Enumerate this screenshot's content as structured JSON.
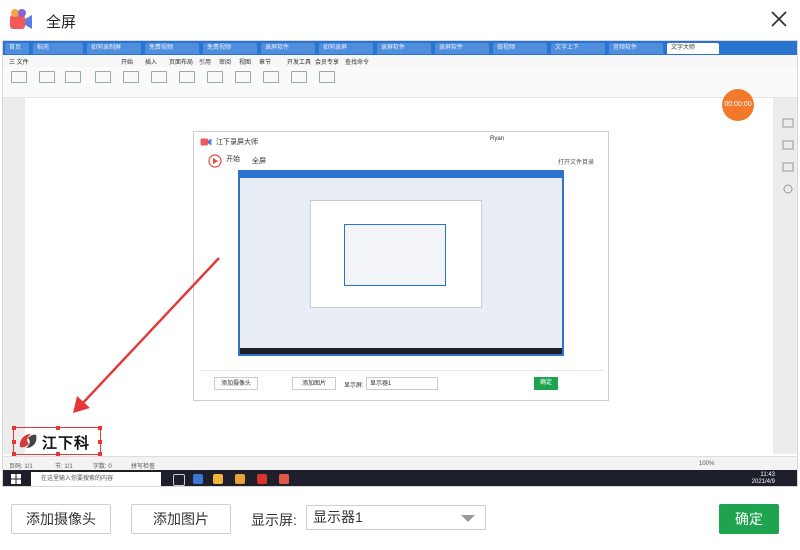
{
  "window": {
    "title": "全屏",
    "logo_icon": "video-camera-icon",
    "close_icon": "close-icon"
  },
  "preview": {
    "browser_tabs": [
      "首页",
      "稻壳",
      "如何录制屏",
      "免费视频",
      "免费视频",
      "录屏软件",
      "如何录屏",
      "录屏软件",
      "录屏软件",
      "做视频",
      "文字上下",
      "音频软件",
      "文字大师"
    ],
    "menu_items": [
      "三 文件",
      "开始",
      "插入",
      "页面布局",
      "引用",
      "审阅",
      "视图",
      "章节",
      "开发工具",
      "会员专享",
      "查找命令"
    ],
    "nested_app": {
      "title": "江下录屏大师",
      "user": "Ryan",
      "start_label": "开始",
      "fullscreen_label": "全屏",
      "right_label": "打开文件目录",
      "add_camera": "添加摄像头",
      "add_image": "添加图片",
      "display_label": "显示屏:",
      "display_value": "显示器1",
      "confirm": "确定"
    },
    "overlay_logo_text": "江下科技",
    "status": {
      "page": "页码: 1/1",
      "section": "节: 1/1",
      "words": "字数: 0",
      "spell": "拼写检查",
      "zoom": "100%"
    },
    "taskbar": {
      "search_placeholder": "在这里输入你要搜索的内容",
      "time": "11:43",
      "date": "2021/4/9"
    }
  },
  "controls": {
    "add_camera": "添加摄像头",
    "add_image": "添加图片",
    "display_label": "显示屏:",
    "display_value": "显示器1",
    "confirm": "确定"
  },
  "colors": {
    "accent_green": "#1ea44f",
    "tab_blue": "#2a73cf",
    "record_orange": "#f2792c",
    "selection_red": "#e43838"
  }
}
